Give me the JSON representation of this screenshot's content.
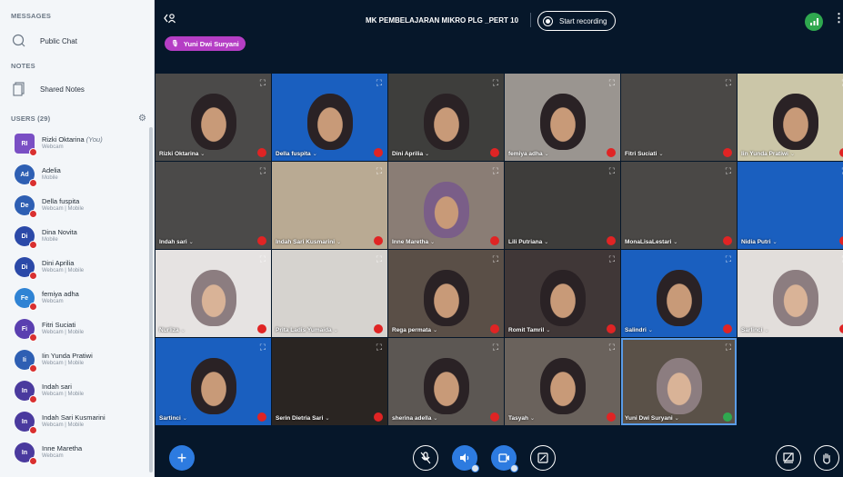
{
  "sidebar": {
    "messages_title": "MESSAGES",
    "public_chat": "Public Chat",
    "notes_title": "NOTES",
    "shared_notes": "Shared Notes",
    "users_title": "USERS (29)",
    "users": [
      {
        "initials": "RI",
        "name": "Rizki Oktarina",
        "you": "(You)",
        "sub": "Webcam",
        "color": "#7a4fc4",
        "square": true
      },
      {
        "initials": "Ad",
        "name": "Adelia",
        "you": "",
        "sub": "Mobile",
        "color": "#2e5fb3",
        "square": false
      },
      {
        "initials": "De",
        "name": "Della fuspita",
        "you": "",
        "sub": "Webcam | Mobile",
        "color": "#2e5fb3",
        "square": false
      },
      {
        "initials": "Di",
        "name": "Dina Novita",
        "you": "",
        "sub": "Mobile",
        "color": "#2b49a8",
        "square": false
      },
      {
        "initials": "Di",
        "name": "Dini Aprilia",
        "you": "",
        "sub": "Webcam | Mobile",
        "color": "#2b49a8",
        "square": false
      },
      {
        "initials": "Fe",
        "name": "femiya adha",
        "you": "",
        "sub": "Webcam",
        "color": "#2f83d4",
        "square": false
      },
      {
        "initials": "Fi",
        "name": "Fitri Suciati",
        "you": "",
        "sub": "Webcam | Mobile",
        "color": "#5a3fb0",
        "square": false
      },
      {
        "initials": "Ii",
        "name": "Iin Yunda Pratiwi",
        "you": "",
        "sub": "Webcam | Mobile",
        "color": "#2e5fb3",
        "square": false
      },
      {
        "initials": "In",
        "name": "Indah sari",
        "you": "",
        "sub": "Webcam | Mobile",
        "color": "#4a3a9e",
        "square": false
      },
      {
        "initials": "In",
        "name": "Indah Sari Kusmarini",
        "you": "",
        "sub": "Webcam | Mobile",
        "color": "#4a3a9e",
        "square": false
      },
      {
        "initials": "In",
        "name": "Inne Maretha",
        "you": "",
        "sub": "Webcam",
        "color": "#4a3a9e",
        "square": false
      }
    ]
  },
  "topbar": {
    "back_icon": "‹",
    "meeting_title": "MK PEMBELAJARAN MIKRO PLG _PERT 10",
    "record_label": "Start recording",
    "presenter_name": "Yuni Dwi Suryani",
    "connection_icon": "signal-icon",
    "more_icon": "⋮"
  },
  "tiles": [
    {
      "name": "Rizki Oktarina",
      "bg": "#4b4a49",
      "face": "dark",
      "muted": true
    },
    {
      "name": "Della fuspita",
      "bg": "#1a5fbf",
      "face": "dark",
      "muted": true
    },
    {
      "name": "Dini Aprilia",
      "bg": "#3e3e3c",
      "face": "dark",
      "muted": true
    },
    {
      "name": "femiya adha",
      "bg": "#9a9590",
      "face": "dark",
      "muted": true
    },
    {
      "name": "Fitri Suciati",
      "bg": "#4a4846",
      "face": "none",
      "muted": true
    },
    {
      "name": "Iin Yunda Pratiwi",
      "bg": "#cbc6a8",
      "face": "dark",
      "muted": true
    },
    {
      "name": "Indah sari",
      "bg": "#4b4a49",
      "face": "none",
      "muted": true
    },
    {
      "name": "Indah Sari Kusmarini",
      "bg": "#b9aa93",
      "face": "none",
      "muted": true
    },
    {
      "name": "Inne Maretha",
      "bg": "#8a7d75",
      "face": "mask",
      "muted": true
    },
    {
      "name": "Lili Putriana",
      "bg": "#3e3d3b",
      "face": "none",
      "muted": true
    },
    {
      "name": "MonaLisaLestari",
      "bg": "#4a4846",
      "face": "none",
      "muted": true
    },
    {
      "name": "Nidia Putri",
      "bg": "#1a5fbf",
      "face": "none",
      "muted": true
    },
    {
      "name": "Nurliza",
      "bg": "#e6e3e2",
      "face": "light",
      "muted": true
    },
    {
      "name": "Prita Ladis Yumaida",
      "bg": "#d6d3cf",
      "face": "none",
      "muted": true
    },
    {
      "name": "Rega permata",
      "bg": "#5a4f47",
      "face": "dark",
      "muted": true
    },
    {
      "name": "Romit Tamril",
      "bg": "#403737",
      "face": "dark",
      "muted": true
    },
    {
      "name": "Salindri",
      "bg": "#1a5fbf",
      "face": "dark",
      "muted": true
    },
    {
      "name": "Sarlinci",
      "bg": "#e2dedb",
      "face": "light",
      "muted": true
    },
    {
      "name": "Sartinci",
      "bg": "#1a5fbf",
      "face": "dark",
      "muted": true
    },
    {
      "name": "Serin Dietria Sari",
      "bg": "#2a2522",
      "face": "none",
      "muted": true
    },
    {
      "name": "sherina adella",
      "bg": "#5c5753",
      "face": "dark",
      "muted": true
    },
    {
      "name": "Tasyah",
      "bg": "#6a625c",
      "face": "dark",
      "muted": true
    },
    {
      "name": "Yuni Dwi Suryani",
      "bg": "#5a5148",
      "face": "light",
      "muted": false,
      "active": true
    }
  ],
  "controls": {
    "add_icon": "+",
    "mic_icon": "microphone-off-icon",
    "audio_icon": "speaker-icon",
    "video_icon": "camera-icon",
    "share_icon": "screen-share-icon",
    "layout_icon": "layout-icon",
    "raise_hand_icon": "raise-hand-icon"
  }
}
